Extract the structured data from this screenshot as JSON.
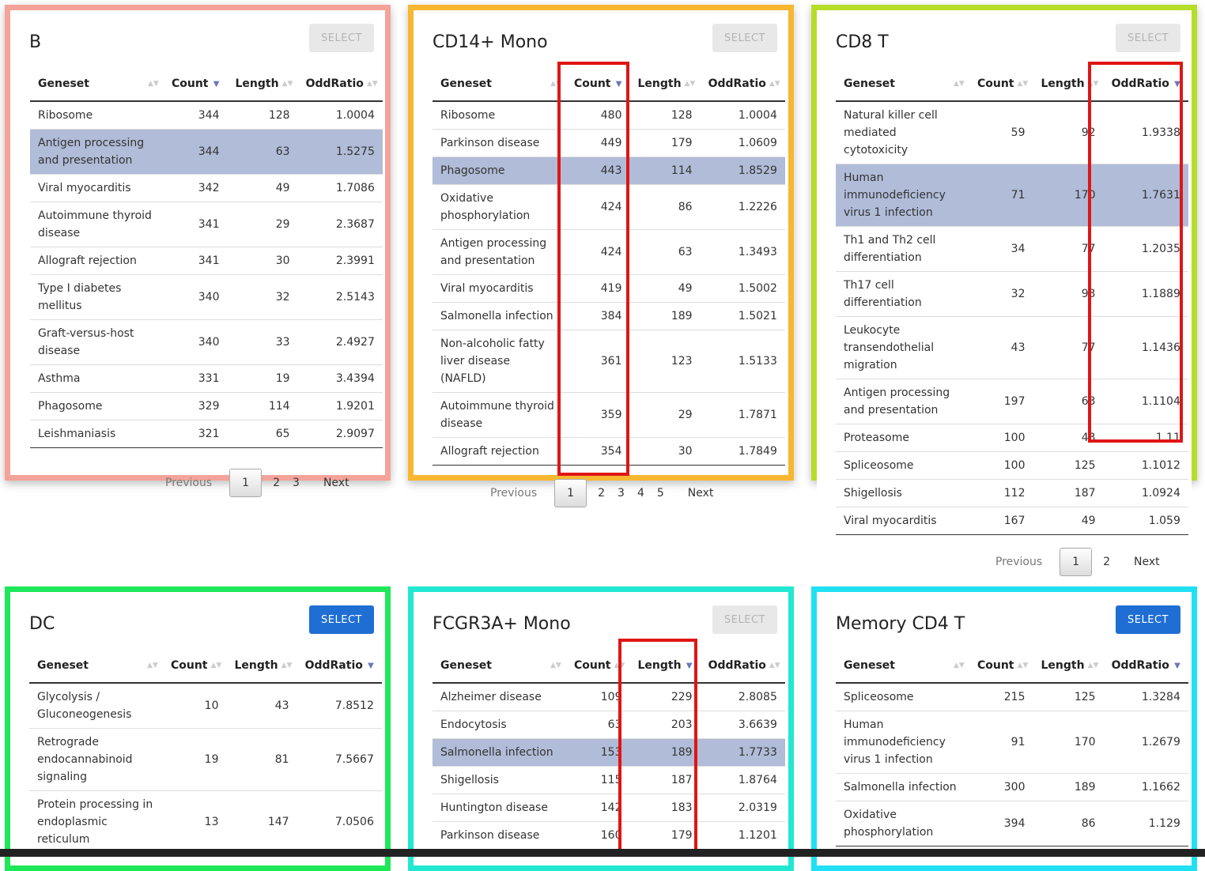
{
  "headers": {
    "geneset": "Geneset",
    "count": "Count",
    "length": "Length",
    "oddratio": "OddRatio"
  },
  "pager_labels": {
    "previous": "Previous",
    "next": "Next"
  },
  "panels": {
    "b": {
      "title": "B",
      "button": "SELECT",
      "pages": [
        "1",
        "2",
        "3"
      ],
      "rows": [
        {
          "g": "Ribosome",
          "c": "344",
          "l": "128",
          "o": "1.0004"
        },
        {
          "g": "Antigen processing and presentation",
          "c": "344",
          "l": "63",
          "o": "1.5275"
        },
        {
          "g": "Viral myocarditis",
          "c": "342",
          "l": "49",
          "o": "1.7086"
        },
        {
          "g": "Autoimmune thyroid disease",
          "c": "341",
          "l": "29",
          "o": "2.3687"
        },
        {
          "g": "Allograft rejection",
          "c": "341",
          "l": "30",
          "o": "2.3991"
        },
        {
          "g": "Type I diabetes mellitus",
          "c": "340",
          "l": "32",
          "o": "2.5143"
        },
        {
          "g": "Graft-versus-host disease",
          "c": "340",
          "l": "33",
          "o": "2.4927"
        },
        {
          "g": "Asthma",
          "c": "331",
          "l": "19",
          "o": "3.4394"
        },
        {
          "g": "Phagosome",
          "c": "329",
          "l": "114",
          "o": "1.9201"
        },
        {
          "g": "Leishmaniasis",
          "c": "321",
          "l": "65",
          "o": "2.9097"
        }
      ]
    },
    "cd14": {
      "title": "CD14+ Mono",
      "button": "SELECT",
      "pages": [
        "1",
        "2",
        "3",
        "4",
        "5"
      ],
      "rows": [
        {
          "g": "Ribosome",
          "c": "480",
          "l": "128",
          "o": "1.0004"
        },
        {
          "g": "Parkinson disease",
          "c": "449",
          "l": "179",
          "o": "1.0609"
        },
        {
          "g": "Phagosome",
          "c": "443",
          "l": "114",
          "o": "1.8529"
        },
        {
          "g": "Oxidative phosphorylation",
          "c": "424",
          "l": "86",
          "o": "1.2226"
        },
        {
          "g": "Antigen processing and presentation",
          "c": "424",
          "l": "63",
          "o": "1.3493"
        },
        {
          "g": "Viral myocarditis",
          "c": "419",
          "l": "49",
          "o": "1.5002"
        },
        {
          "g": "Salmonella infection",
          "c": "384",
          "l": "189",
          "o": "1.5021"
        },
        {
          "g": "Non-alcoholic fatty liver disease (NAFLD)",
          "c": "361",
          "l": "123",
          "o": "1.5133"
        },
        {
          "g": "Autoimmune thyroid disease",
          "c": "359",
          "l": "29",
          "o": "1.7871"
        },
        {
          "g": "Allograft rejection",
          "c": "354",
          "l": "30",
          "o": "1.7849"
        }
      ]
    },
    "cd8": {
      "title": "CD8 T",
      "button": "SELECT",
      "pages": [
        "1",
        "2"
      ],
      "rows": [
        {
          "g": "Natural killer cell mediated cytotoxicity",
          "c": "59",
          "l": "92",
          "o": "1.9338"
        },
        {
          "g": "Human immunodeficiency virus 1 infection",
          "c": "71",
          "l": "170",
          "o": "1.7631"
        },
        {
          "g": "Th1 and Th2 cell differentiation",
          "c": "34",
          "l": "77",
          "o": "1.2035"
        },
        {
          "g": "Th17 cell differentiation",
          "c": "32",
          "l": "93",
          "o": "1.1889"
        },
        {
          "g": "Leukocyte transendothelial migration",
          "c": "43",
          "l": "77",
          "o": "1.1436"
        },
        {
          "g": "Antigen processing and presentation",
          "c": "197",
          "l": "63",
          "o": "1.1104"
        },
        {
          "g": "Proteasome",
          "c": "100",
          "l": "43",
          "o": "1.11"
        },
        {
          "g": "Spliceosome",
          "c": "100",
          "l": "125",
          "o": "1.1012"
        },
        {
          "g": "Shigellosis",
          "c": "112",
          "l": "187",
          "o": "1.0924"
        },
        {
          "g": "Viral myocarditis",
          "c": "167",
          "l": "49",
          "o": "1.059"
        }
      ]
    },
    "dc": {
      "title": "DC",
      "button": "SELECT",
      "rows": [
        {
          "g": "Glycolysis / Gluconeogenesis",
          "c": "10",
          "l": "43",
          "o": "7.8512"
        },
        {
          "g": "Retrograde endocannabinoid signaling",
          "c": "19",
          "l": "81",
          "o": "7.5667"
        },
        {
          "g": "Protein processing in endoplasmic reticulum",
          "c": "13",
          "l": "147",
          "o": "7.0506"
        }
      ]
    },
    "fcgr": {
      "title": "FCGR3A+ Mono",
      "button": "SELECT",
      "rows": [
        {
          "g": "Alzheimer disease",
          "c": "109",
          "l": "229",
          "o": "2.8085"
        },
        {
          "g": "Endocytosis",
          "c": "63",
          "l": "203",
          "o": "3.6639"
        },
        {
          "g": "Salmonella infection",
          "c": "153",
          "l": "189",
          "o": "1.7733"
        },
        {
          "g": "Shigellosis",
          "c": "115",
          "l": "187",
          "o": "1.8764"
        },
        {
          "g": "Huntington disease",
          "c": "142",
          "l": "183",
          "o": "2.0319"
        },
        {
          "g": "Parkinson disease",
          "c": "160",
          "l": "179",
          "o": "1.1201"
        }
      ]
    },
    "mem": {
      "title": "Memory CD4 T",
      "button": "SELECT",
      "rows": [
        {
          "g": "Spliceosome",
          "c": "215",
          "l": "125",
          "o": "1.3284"
        },
        {
          "g": "Human immunodeficiency virus 1 infection",
          "c": "91",
          "l": "170",
          "o": "1.2679"
        },
        {
          "g": "Salmonella infection",
          "c": "300",
          "l": "189",
          "o": "1.1662"
        },
        {
          "g": "Oxidative phosphorylation",
          "c": "394",
          "l": "86",
          "o": "1.129"
        }
      ]
    }
  },
  "colors": {
    "b": "#f4a39a",
    "cd14": "#f7b731",
    "cd8": "#b6dd2a",
    "dc": "#1ee85a",
    "fcgr": "#22e8d2",
    "mem": "#22e0f4",
    "highlight": "#b0bcd8",
    "select_active": "#1f6ed4",
    "annotation": "#e01515"
  }
}
